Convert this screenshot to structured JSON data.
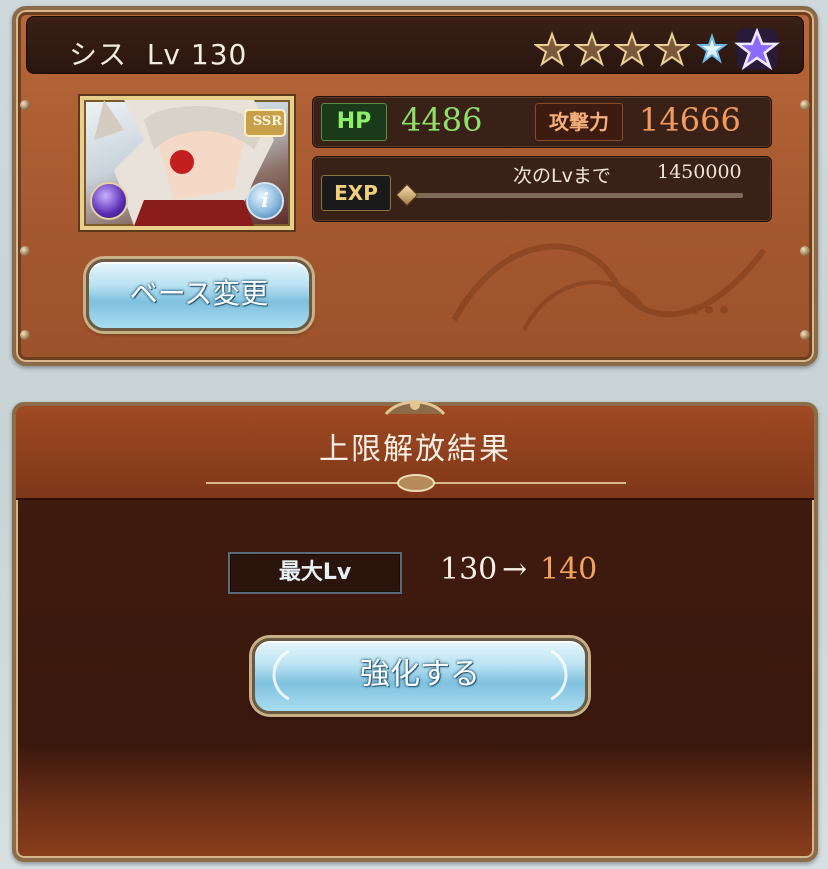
{
  "character": {
    "name": "シス",
    "level_label": "Lv",
    "level": "130",
    "rarity_badge": "SSR",
    "stars_total": 6,
    "stars_filled": 6,
    "hp_label": "HP",
    "hp_value": "4486",
    "atk_label": "攻撃力",
    "atk_value": "14666",
    "exp_label": "EXP",
    "next_level_label": "次のLvまで",
    "next_level_value": "1450000",
    "exp_progress": 0.0,
    "base_change_label": "ベース変更",
    "info_icon": "i"
  },
  "result": {
    "title": "上限解放結果",
    "max_lv_label": "最大Lv",
    "from_level": "130",
    "arrow": "→",
    "to_level": "140",
    "enhance_label": "強化する"
  },
  "colors": {
    "hp": "#8fe06a",
    "atk": "#f29a5c",
    "to_level": "#f2a35e"
  }
}
